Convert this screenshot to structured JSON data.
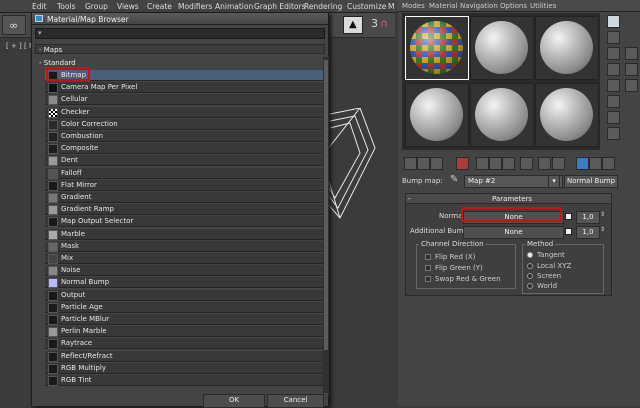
{
  "menubar": {
    "items": [
      "Edit",
      "Tools",
      "Group",
      "Views",
      "Create",
      "Modifiers",
      "Animation",
      "Graph Editors",
      "Rendering",
      "Customize",
      "M"
    ]
  },
  "viewport": {
    "label": "[ + ] [ Pe"
  },
  "browser": {
    "title": "Material/Map Browser",
    "section": "- Maps",
    "subsection": "- Standard",
    "items": [
      {
        "label": "Bitmap",
        "selected": true
      },
      {
        "label": "Camera Map Per Pixel"
      },
      {
        "label": "Cellular"
      },
      {
        "label": "Checker"
      },
      {
        "label": "Color Correction"
      },
      {
        "label": "Combustion"
      },
      {
        "label": "Composite"
      },
      {
        "label": "Dent"
      },
      {
        "label": "Falloff"
      },
      {
        "label": "Flat Mirror"
      },
      {
        "label": "Gradient"
      },
      {
        "label": "Gradient Ramp"
      },
      {
        "label": "Map Output Selector"
      },
      {
        "label": "Marble"
      },
      {
        "label": "Mask"
      },
      {
        "label": "Mix"
      },
      {
        "label": "Noise"
      },
      {
        "label": "Normal Bump"
      },
      {
        "label": "Output"
      },
      {
        "label": "Particle Age"
      },
      {
        "label": "Particle MBlur"
      },
      {
        "label": "Perlin Marble"
      },
      {
        "label": "Raytrace"
      },
      {
        "label": "Reflect/Refract"
      },
      {
        "label": "RGB Multiply"
      },
      {
        "label": "RGB Tint"
      }
    ],
    "ok_label": "OK",
    "cancel_label": "Cancel"
  },
  "editor": {
    "menu": [
      "Modes",
      "Material",
      "Navigation",
      "Options",
      "Utilities"
    ],
    "bump_label": "Bump map:",
    "map_name": "Map #2",
    "map_type": "Normal Bump",
    "params_title": "Parameters",
    "normal_label": "Normal:",
    "normal_value": "None",
    "normal_amount": "1,0",
    "additional_label": "Additional Bump:",
    "additional_value": "None",
    "additional_amount": "1,0",
    "channel_title": "Channel Direction",
    "flip_red": "Flip Red (X)",
    "flip_green": "Flip Green (Y)",
    "swap": "Swap Red & Green",
    "method_title": "Method",
    "methods": [
      "Tangent",
      "Local XYZ",
      "Screen",
      "World"
    ],
    "selected_method": "Tangent"
  },
  "colors": {
    "highlight": "#d01010",
    "selection": "#49607a"
  }
}
